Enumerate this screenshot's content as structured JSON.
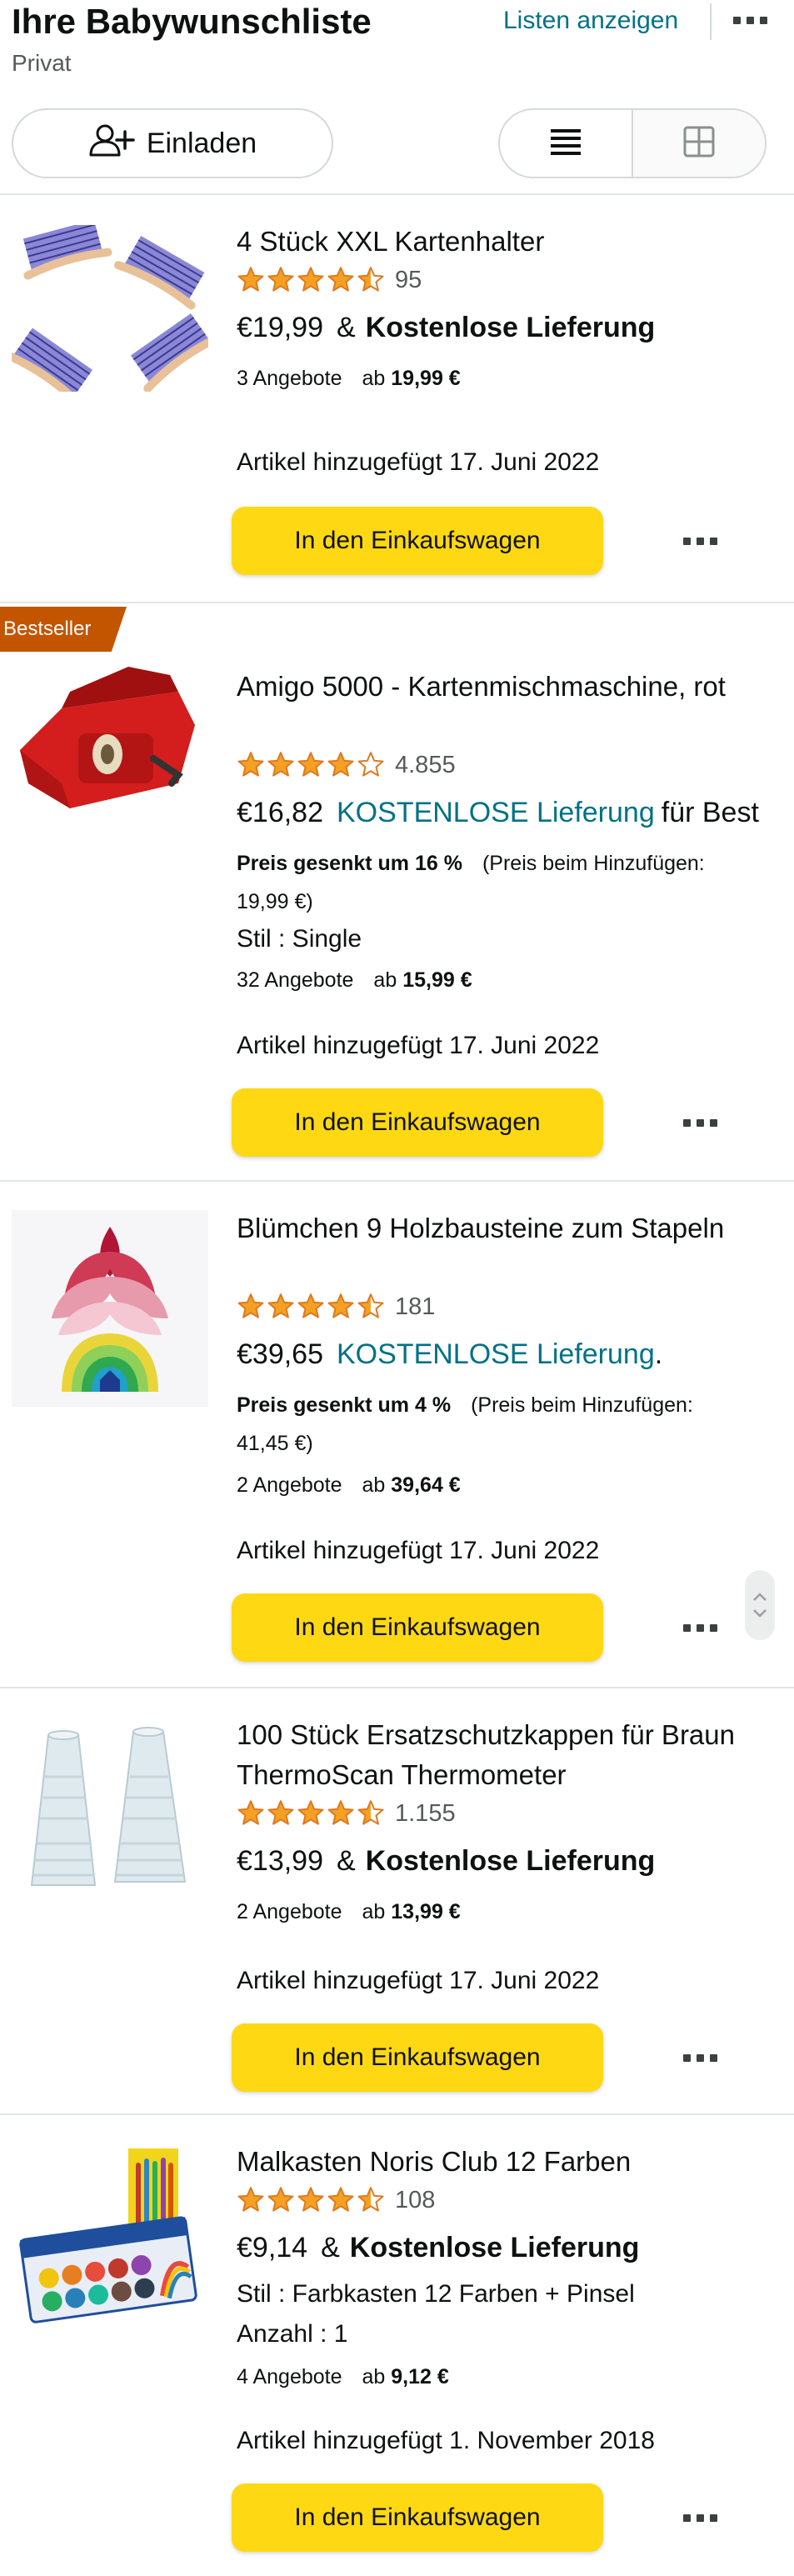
{
  "header": {
    "title": "Ihre Babywunschliste",
    "privacy": "Privat",
    "show_lists": "Listen anzeigen",
    "more_icon": "more-dots-icon",
    "invite_label": "Einladen",
    "invite_icon": "add-person-icon",
    "view_modes": [
      "list-view-icon",
      "grid-view-icon"
    ],
    "active_view": "list"
  },
  "colors": {
    "accent_link": "#007185",
    "cart_button": "#FFD814",
    "star": "#F4A123",
    "badge": "#C45500",
    "text": "#0F1111",
    "muted": "#565959"
  },
  "items": [
    {
      "title": "4 Stück XXL Kartenhalter",
      "rating": 4.5,
      "rating_count": "95",
      "price": "€19,99",
      "shipping_prefix": "&",
      "shipping": "Kostenlose Lieferung",
      "offers": "3 Angebote",
      "offers_from_prefix": "ab",
      "offers_from": "19,99 €",
      "added": "Artikel hinzugefügt 17. Juni 2022",
      "cart_label": "In den Einkaufswagen"
    },
    {
      "badge": "Bestseller",
      "title": "Amigo 5000 - Kartenmischmaschine, rot",
      "rating": 4.0,
      "rating_count": "4.855",
      "price": "€16,82",
      "shipping_link": "KOSTENLOSE Lieferung",
      "shipping_tail": "für Best",
      "price_drop": "Preis gesenkt um 16 %",
      "price_at_add_1": "(Preis beim Hinzufügen:",
      "price_at_add_2": "19,99 €)",
      "style": "Stil : Single",
      "offers": "32 Angebote",
      "offers_from_prefix": "ab",
      "offers_from": "15,99 €",
      "added": "Artikel hinzugefügt 17. Juni 2022",
      "cart_label": "In den Einkaufswagen"
    },
    {
      "title": "Blümchen 9 Holzbausteine zum Stapeln",
      "rating": 4.5,
      "rating_count": "181",
      "price": "€39,65",
      "shipping_link": "KOSTENLOSE Lieferung",
      "shipping_tail": ".",
      "price_drop": "Preis gesenkt um 4 %",
      "price_at_add_1": "(Preis beim Hinzufügen:",
      "price_at_add_2": "41,45 €)",
      "offers": "2 Angebote",
      "offers_from_prefix": "ab",
      "offers_from": "39,64 €",
      "added": "Artikel hinzugefügt 17. Juni 2022",
      "cart_label": "In den Einkaufswagen"
    },
    {
      "title": "100 Stück Ersatzschutzkappen für Braun ThermoScan Thermometer",
      "rating": 4.5,
      "rating_count": "1.155",
      "price": "€13,99",
      "shipping_prefix": "&",
      "shipping": "Kostenlose Lieferung",
      "offers": "2 Angebote",
      "offers_from_prefix": "ab",
      "offers_from": "13,99 €",
      "added": "Artikel hinzugefügt 17. Juni 2022",
      "cart_label": "In den Einkaufswagen"
    },
    {
      "title": "Malkasten Noris Club 12 Farben",
      "rating": 4.5,
      "rating_count": "108",
      "price": "€9,14",
      "shipping_prefix": "&",
      "shipping": "Kostenlose Lieferung",
      "style": "Stil : Farbkasten 12 Farben + Pinsel",
      "quantity": "Anzahl : 1",
      "offers": "4 Angebote",
      "offers_from_prefix": "ab",
      "offers_from": "9,12 €",
      "added": "Artikel hinzugefügt 1. November 2018",
      "cart_label": "In den Einkaufswagen"
    }
  ]
}
